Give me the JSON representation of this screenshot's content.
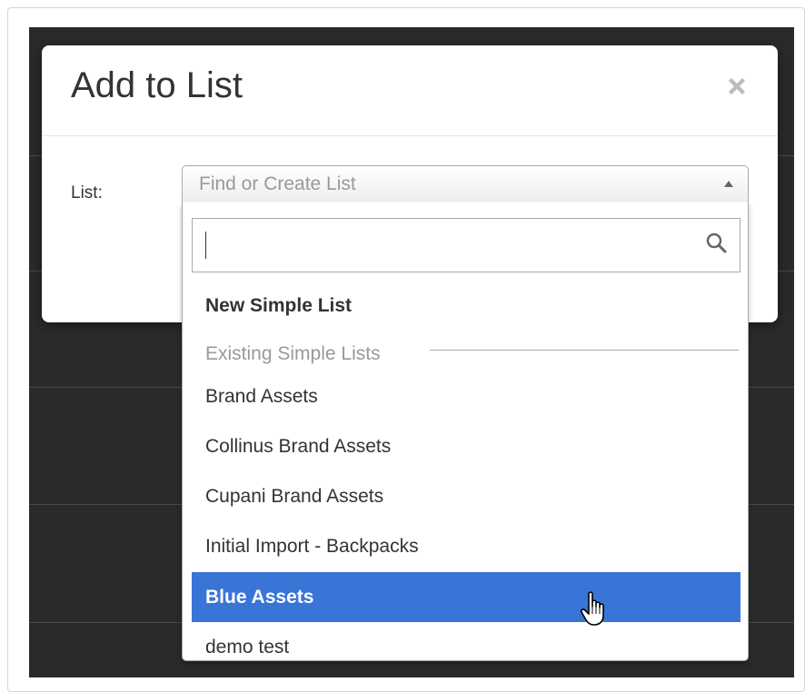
{
  "modal": {
    "title": "Add to List",
    "close_icon": "close-icon",
    "list_label": "List:",
    "select": {
      "placeholder": "Find or Create List",
      "caret_icon": "caret-up-icon"
    },
    "dropdown": {
      "search": {
        "value": "",
        "icon": "search-icon"
      },
      "new_option": "New Simple List",
      "group_label": "Existing Simple Lists",
      "options": [
        {
          "label": "Brand Assets",
          "highlighted": false
        },
        {
          "label": "Collinus Brand Assets",
          "highlighted": false
        },
        {
          "label": "Cupani Brand Assets",
          "highlighted": false
        },
        {
          "label": "Initial Import - Backpacks",
          "highlighted": false
        },
        {
          "label": "Blue Assets",
          "highlighted": true
        },
        {
          "label": "demo test",
          "highlighted": false
        }
      ]
    }
  },
  "colors": {
    "highlight": "#3875d7",
    "backdrop": "#2a2a2a"
  }
}
